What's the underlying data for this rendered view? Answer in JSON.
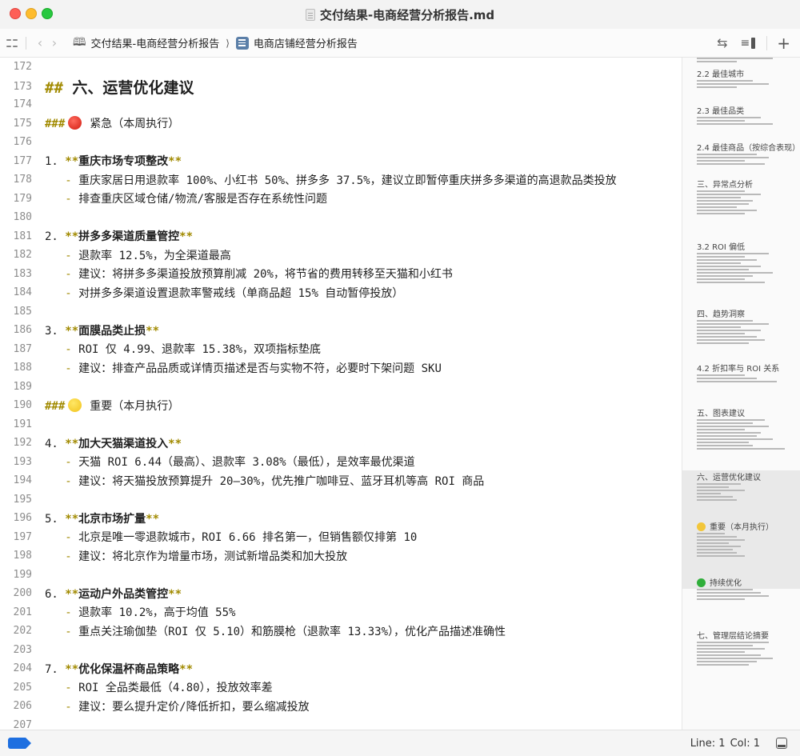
{
  "window": {
    "title": "交付结果-电商经营分析报告.md"
  },
  "toolbar": {
    "breadcrumb_parent": "交付结果-电商经营分析报告",
    "breadcrumb_current": "电商店铺经营分析报告"
  },
  "editor": {
    "lines": [
      {
        "n": "172",
        "kind": "blank"
      },
      {
        "n": "173",
        "kind": "h2",
        "mark": "##",
        "text": "六、运营优化建议"
      },
      {
        "n": "174",
        "kind": "blank"
      },
      {
        "n": "175",
        "kind": "h3",
        "mark": "###",
        "emoji": "red",
        "text": "紧急（本周执行）"
      },
      {
        "n": "176",
        "kind": "blank"
      },
      {
        "n": "177",
        "kind": "item",
        "num": "1.",
        "text": "重庆市场专项整改"
      },
      {
        "n": "178",
        "kind": "sub",
        "text": "重庆家居日用退款率 100%、小红书 50%、拼多多 37.5%，建议立即暂停重庆拼多多渠道的高退款品类投放"
      },
      {
        "n": "179",
        "kind": "sub",
        "text": "排查重庆区域仓储/物流/客服是否存在系统性问题"
      },
      {
        "n": "180",
        "kind": "blank"
      },
      {
        "n": "181",
        "kind": "item",
        "num": "2.",
        "text": "拼多多渠道质量管控"
      },
      {
        "n": "182",
        "kind": "sub",
        "text": "退款率 12.5%，为全渠道最高"
      },
      {
        "n": "183",
        "kind": "sub",
        "text": "建议：将拼多多渠道投放预算削减 20%，将节省的费用转移至天猫和小红书"
      },
      {
        "n": "184",
        "kind": "sub",
        "text": "对拼多多渠道设置退款率警戒线（单商品超 15% 自动暂停投放）"
      },
      {
        "n": "185",
        "kind": "blank"
      },
      {
        "n": "186",
        "kind": "item",
        "num": "3.",
        "text": "面膜品类止损"
      },
      {
        "n": "187",
        "kind": "sub",
        "text": "ROI 仅 4.99、退款率 15.38%，双项指标垫底"
      },
      {
        "n": "188",
        "kind": "sub",
        "text": "建议：排查产品品质或详情页描述是否与实物不符，必要时下架问题 SKU"
      },
      {
        "n": "189",
        "kind": "blank"
      },
      {
        "n": "190",
        "kind": "h3",
        "mark": "###",
        "emoji": "yellow",
        "text": "重要（本月执行）"
      },
      {
        "n": "191",
        "kind": "blank"
      },
      {
        "n": "192",
        "kind": "item",
        "num": "4.",
        "text": "加大天猫渠道投入"
      },
      {
        "n": "193",
        "kind": "sub",
        "text": "天猫 ROI 6.44（最高）、退款率 3.08%（最低），是效率最优渠道"
      },
      {
        "n": "194",
        "kind": "sub",
        "text": "建议：将天猫投放预算提升 20–30%，优先推广咖啡豆、蓝牙耳机等高 ROI 商品"
      },
      {
        "n": "195",
        "kind": "blank"
      },
      {
        "n": "196",
        "kind": "item",
        "num": "5.",
        "text": "北京市场扩量"
      },
      {
        "n": "197",
        "kind": "sub",
        "text": "北京是唯一零退款城市，ROI 6.66 排名第一，但销售额仅排第 10"
      },
      {
        "n": "198",
        "kind": "sub",
        "text": "建议：将北京作为增量市场，测试新增品类和加大投放"
      },
      {
        "n": "199",
        "kind": "blank"
      },
      {
        "n": "200",
        "kind": "item",
        "num": "6.",
        "text": "运动户外品类管控"
      },
      {
        "n": "201",
        "kind": "sub",
        "text": "退款率 10.2%，高于均值 55%"
      },
      {
        "n": "202",
        "kind": "sub",
        "text": "重点关注瑜伽垫（ROI 仅 5.10）和筋膜枪（退款率 13.33%），优化产品描述准确性"
      },
      {
        "n": "203",
        "kind": "blank"
      },
      {
        "n": "204",
        "kind": "item",
        "num": "7.",
        "text": "优化保温杯商品策略"
      },
      {
        "n": "205",
        "kind": "sub",
        "text": "ROI 全品类最低（4.80），投放效率差"
      },
      {
        "n": "206",
        "kind": "sub",
        "text": "建议：要么提升定价/降低折扣，要么缩减投放"
      },
      {
        "n": "207",
        "kind": "blank"
      }
    ]
  },
  "minimap": {
    "headings": [
      {
        "text": "2.2 最佳城市"
      },
      {
        "text": "2.3 最佳品类"
      },
      {
        "text": "2.4 最佳商品（按综合表现）"
      },
      {
        "text": "三、异常点分析"
      },
      {
        "text": "3.2 ROI 偏低"
      },
      {
        "text": "四、趋势洞察"
      },
      {
        "text": "4.2 折扣率与 ROI 关系"
      },
      {
        "text": "五、图表建议"
      },
      {
        "text": "六、运营优化建议"
      },
      {
        "text": "重要（本月执行）",
        "emoji": "yellow"
      },
      {
        "text": "持续优化",
        "emoji": "green"
      },
      {
        "text": "七、管理层结论摘要"
      }
    ]
  },
  "status": {
    "line": "Line: 1",
    "col": "Col: 1"
  },
  "colors": {
    "markdown_marker": "#a18a00",
    "status_tag": "#1e6fe0"
  }
}
